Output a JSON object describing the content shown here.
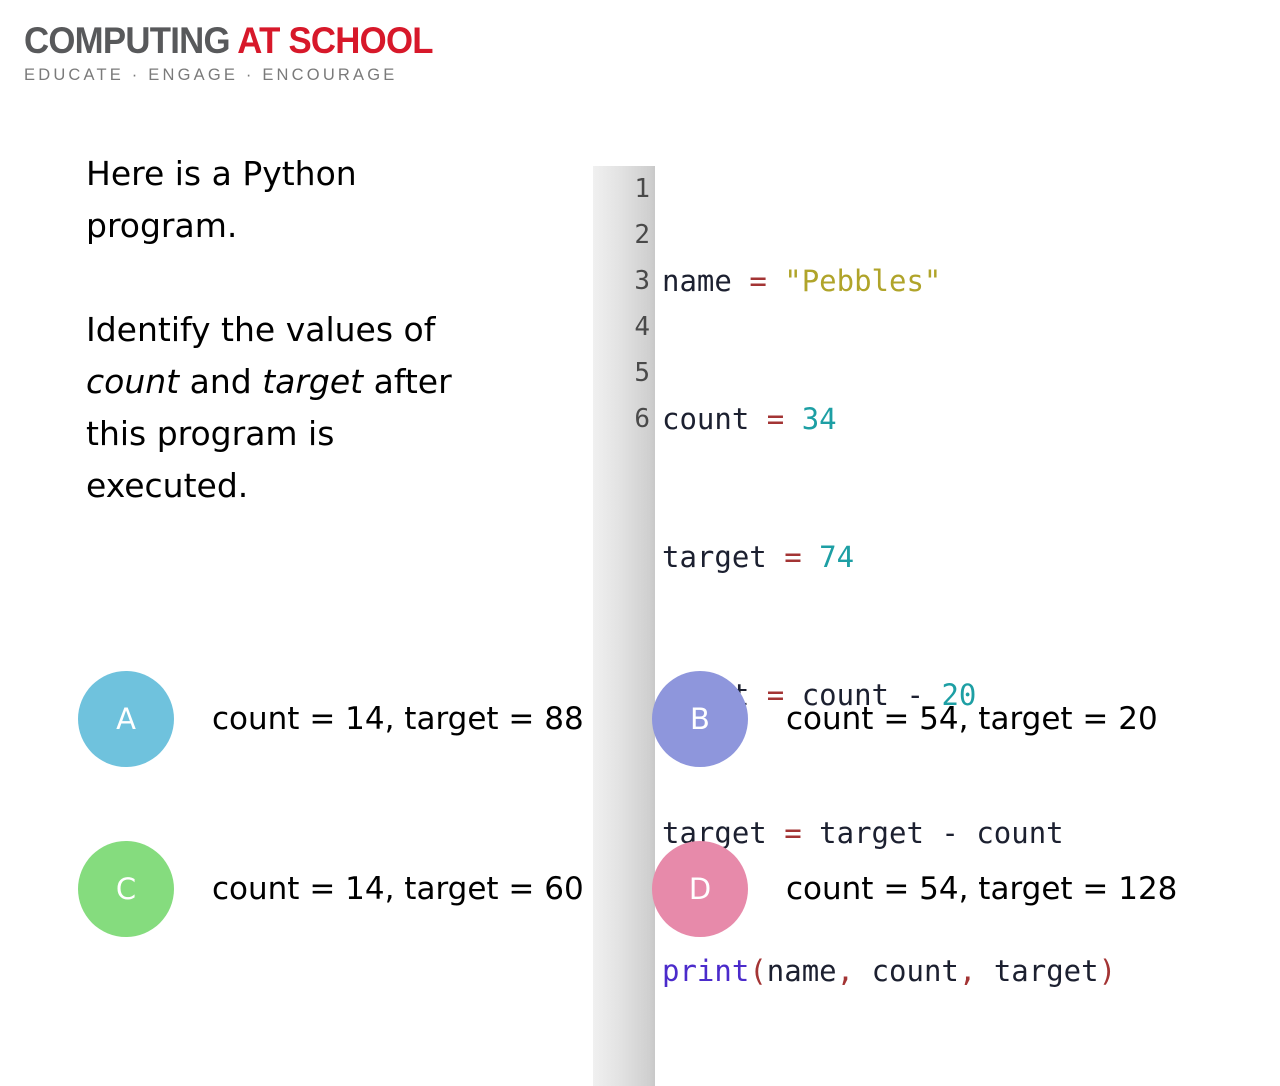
{
  "logo": {
    "word_primary": "COMPUTING",
    "word_accent": "AT SCHOOL",
    "tagline": "EDUCATE · ENGAGE · ENCOURAGE",
    "primary_color": "#58595B",
    "accent_color": "#D7182A",
    "tagline_color": "#7A7A7A"
  },
  "prose": {
    "paragraph_1": "Here is a Python program.",
    "paragraph_2_pre": "Identify the values of ",
    "paragraph_2_em1": "count",
    "paragraph_2_mid": " and ",
    "paragraph_2_em2": "target",
    "paragraph_2_post": " after this program is executed."
  },
  "code": {
    "language": "python",
    "line_numbers": [
      "1",
      "2",
      "3",
      "4",
      "5",
      "6"
    ],
    "lines": [
      "name = \"Pebbles\"",
      "count = 34",
      "target = 74",
      "count = count - 20",
      "target = target - count",
      "print(name, count, target)"
    ],
    "tokens": {
      "l1_name": "name",
      "l1_eq": "=",
      "l1_str": "\"Pebbles\"",
      "l2_name": "count",
      "l2_eq": "=",
      "l2_num": "34",
      "l3_name": "target",
      "l3_eq": "=",
      "l3_num": "74",
      "l4_name": "count",
      "l4_eq": "=",
      "l4_name2": "count",
      "l4_minus": "-",
      "l4_num": "20",
      "l5_name": "target",
      "l5_eq": "=",
      "l5_name2": "target",
      "l5_minus": "-",
      "l5_name3": "count",
      "l6_func": "print",
      "l6_open": "(",
      "l6_a": "name",
      "l6_c1": ",",
      "l6_b": "count",
      "l6_c2": ",",
      "l6_c": "target",
      "l6_close": ")"
    },
    "colors": {
      "identifier": "#1c2030",
      "operator": "#A33434",
      "string": "#B0A42A",
      "number": "#1D9FA4",
      "function": "#4B2BCB",
      "gutter_text": "#4a4a4a"
    }
  },
  "options": [
    {
      "letter": "A",
      "text": "count = 14, target = 88",
      "color": "#6FC2DD"
    },
    {
      "letter": "B",
      "text": "count = 54, target = 20",
      "color": "#8E96DC"
    },
    {
      "letter": "C",
      "text": "count = 14, target = 60",
      "color": "#85DC7E"
    },
    {
      "letter": "D",
      "text": "count = 54, target = 128",
      "color": "#E78AAA"
    }
  ]
}
